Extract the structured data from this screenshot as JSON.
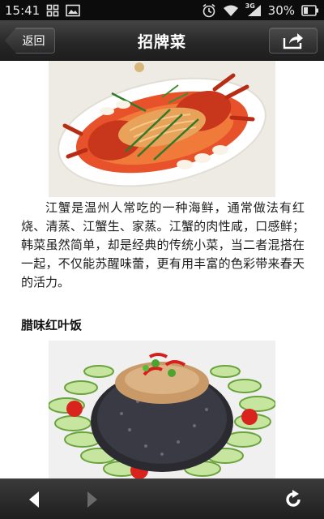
{
  "status_bar": {
    "time": "15:41",
    "signal_type": "3G",
    "battery": "30%",
    "icons": [
      "grid-icon",
      "image-icon",
      "alarm-icon",
      "wifi-icon",
      "signal-icon",
      "battery-icon"
    ]
  },
  "header": {
    "back_label": "返回",
    "title": "招牌菜",
    "share_icon": "share-icon"
  },
  "article": {
    "crab_image": "dish-photo-crab",
    "paragraph": "江蟹是温州人常吃的一种海鲜，通常做法有红烧、清蒸、江蟹生、家蒸。江蟹的肉性咸，口感鲜；韩菜虽然简单，却是经典的传统小菜，当二者混搭在一起，不仅能苏醒味蕾，更有用丰富的色彩带来春天的活力。",
    "section_heading": "腊味红叶饭",
    "rice_image": "dish-photo-rice"
  },
  "bottom_bar": {
    "back_icon": "back-arrow-icon",
    "forward_icon": "forward-arrow-icon",
    "refresh_icon": "refresh-icon"
  },
  "colors": {
    "status_bg": "#0c0c0c",
    "bar_bg": "#262626",
    "text": "#1c1c1c"
  }
}
